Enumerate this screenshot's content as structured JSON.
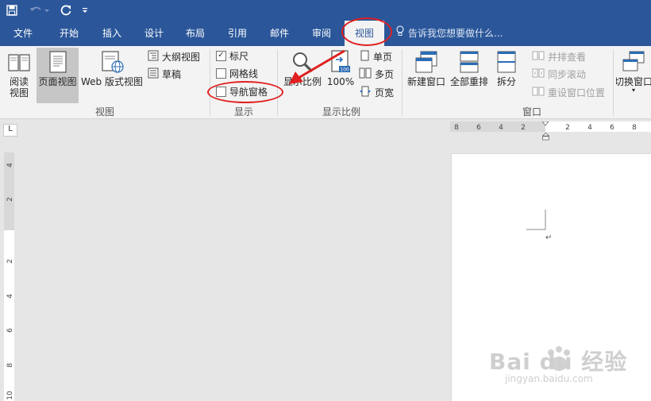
{
  "tabs": [
    {
      "label": "文件"
    },
    {
      "label": "开始"
    },
    {
      "label": "插入"
    },
    {
      "label": "设计"
    },
    {
      "label": "布局"
    },
    {
      "label": "引用"
    },
    {
      "label": "邮件"
    },
    {
      "label": "审阅"
    },
    {
      "label": "视图"
    }
  ],
  "active_tab": "视图",
  "tell_me": "告诉我您想要做什么...",
  "groups": {
    "views": {
      "label": "视图",
      "reading": "阅读\n视图",
      "print_layout": "页面视图",
      "web_layout": "Web 版式视图",
      "outline": "大纲视图",
      "draft": "草稿"
    },
    "show": {
      "label": "显示",
      "ruler": "标尺",
      "gridlines": "网格线",
      "navigation_pane": "导航窗格",
      "ruler_checked": true,
      "gridlines_checked": false,
      "navigation_checked": false
    },
    "zoom": {
      "label": "显示比例",
      "zoom": "显示比例",
      "hundred": "100%",
      "one_page": "单页",
      "multiple_pages": "多页",
      "page_width": "页宽"
    },
    "window": {
      "label": "窗口",
      "new_window": "新建窗口",
      "arrange_all": "全部重排",
      "split": "拆分",
      "side_by_side": "并排查看",
      "sync_scrolling": "同步滚动",
      "reset_position": "重设窗口位置",
      "switch_windows": "切换窗口"
    }
  },
  "hruler_labels": [
    "8",
    "6",
    "4",
    "2",
    "2",
    "4",
    "6",
    "8"
  ],
  "vruler_labels": [
    "4",
    "2",
    "2",
    "4",
    "6",
    "8",
    "10"
  ],
  "watermark": {
    "brand": "Bai du 经验",
    "url": "jingyan.baidu.com"
  },
  "colors": {
    "title_blue": "#2b579a",
    "ribbon_bg": "#f3f3f3",
    "annotation_red": "#e02020"
  }
}
